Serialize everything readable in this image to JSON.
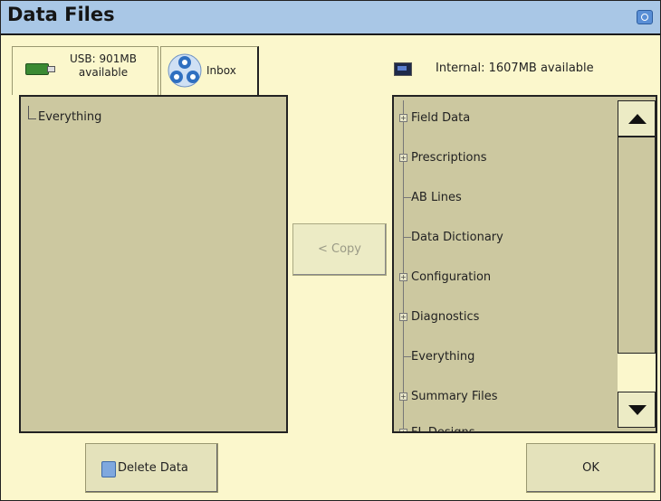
{
  "window": {
    "title": "Data Files",
    "title_icon": "camera-icon"
  },
  "source_tabs": {
    "usb": {
      "label_line1": "USB: 901MB",
      "label_line2": "available",
      "icon": "usb-drive-icon"
    },
    "inbox": {
      "label": "Inbox",
      "icon": "inbox-network-icon"
    }
  },
  "internal": {
    "label": "Internal: 1607MB available",
    "icon": "display-icon"
  },
  "left_panel": {
    "items": [
      {
        "label": "Everything"
      }
    ]
  },
  "copy_button": {
    "label": "< Copy",
    "enabled": false
  },
  "right_panel": {
    "items": [
      {
        "label": "Field Data",
        "expandable": true
      },
      {
        "label": "Prescriptions",
        "expandable": true
      },
      {
        "label": "AB Lines",
        "expandable": false
      },
      {
        "label": "Data Dictionary",
        "expandable": false
      },
      {
        "label": "Configuration",
        "expandable": true
      },
      {
        "label": "Diagnostics",
        "expandable": true
      },
      {
        "label": "Everything",
        "expandable": false
      },
      {
        "label": "Summary Files",
        "expandable": true
      },
      {
        "label": "FL Designs",
        "expandable": true
      }
    ]
  },
  "buttons": {
    "delete": {
      "label": "Delete Data",
      "icon": "delete-files-icon"
    },
    "ok": {
      "label": "OK"
    }
  },
  "colors": {
    "background": "#fbf7cc",
    "titlebar": "#a9c7e6",
    "panel": "#ccc8a0",
    "button": "#e4e2bb",
    "disabled_text": "#9a9a86"
  }
}
